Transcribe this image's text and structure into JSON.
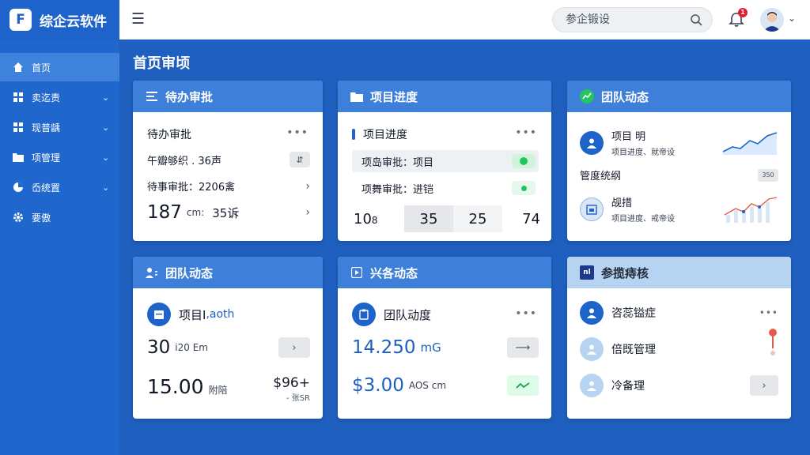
{
  "app": {
    "logo_text": "F",
    "name": "综企云软件"
  },
  "search": {
    "placeholder": "参企锻设"
  },
  "notifications": {
    "count": "1"
  },
  "sidebar": {
    "items": [
      {
        "label": "首页",
        "icon": "home-icon",
        "active": true
      },
      {
        "label": "卖迄责",
        "icon": "grid-icon"
      },
      {
        "label": "现普龋",
        "icon": "grid-icon"
      },
      {
        "label": "项管理",
        "icon": "folder-icon"
      },
      {
        "label": "岙统置",
        "icon": "pie-icon"
      },
      {
        "label": "要傲",
        "icon": "gear-icon"
      }
    ]
  },
  "page": {
    "title": "首页审顷"
  },
  "cards": {
    "pending": {
      "title": "待办审批",
      "subtitle": "待办审批",
      "line1": "午瓣够织 . 36声",
      "line2": "待事审批：2206禽",
      "num": "187",
      "num_unit": "cm:",
      "num2": "35诉",
      "pin": "⇵"
    },
    "progress": {
      "title": "项目进度",
      "subtitle": "项目进度",
      "row1": "项岛审批：项目",
      "row2": "项舞审批：进铠",
      "n1": "10",
      "n1_unit": "8",
      "n2": "35",
      "n3": "25",
      "n4": "74"
    },
    "team": {
      "title": "团队动态",
      "item1_title": "项目  明",
      "item1_sub": "项目进度、就帝设",
      "mid_label": "管度统纲",
      "mid_tag": "350",
      "item2_title": "觇措",
      "item2_sub": "项目进度、戒帝设"
    },
    "team2": {
      "title": "团队动态",
      "item_label": "项目I",
      "item_suffix": ",aoth",
      "n1": "30",
      "n1_unit": "i20 Em",
      "n2": "15.00",
      "n2_unit": "附陪",
      "price": "$96+",
      "price_sub": "- 张SR"
    },
    "tasks": {
      "title": "兴各动态",
      "item_label": "团队动度",
      "n1": "14.250",
      "n1_unit": "mG",
      "n2": "$3.00",
      "n2_unit": "AOS cm"
    },
    "settings": {
      "title": "参揽痔核",
      "item1": "咨蕊镒症",
      "item2": "倍既管理",
      "item3": "冷备理"
    }
  },
  "colors": {
    "background": "#1f5fbf",
    "sidebar": "#1f66cd",
    "card_header": "#3d7fd9",
    "card_header_light": "#b7d3f2",
    "accent_green": "#22c55e",
    "badge_red": "#e11d2e"
  }
}
